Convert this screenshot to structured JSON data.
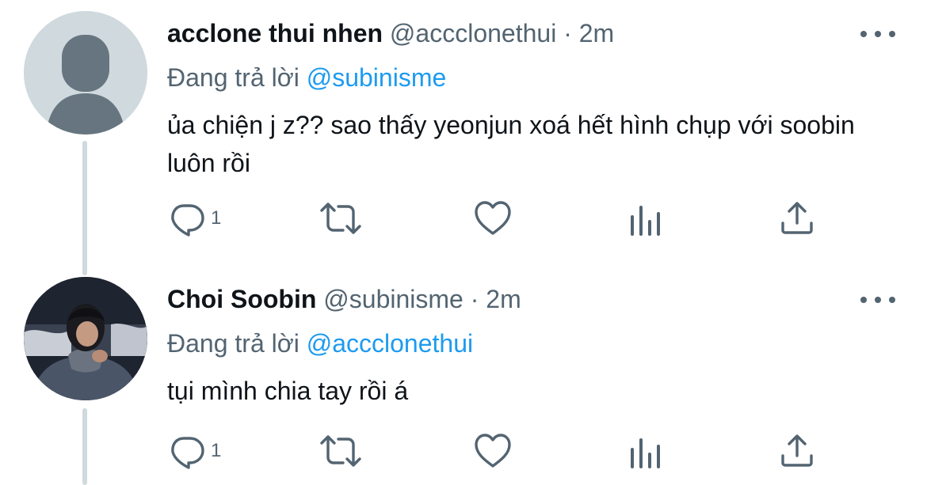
{
  "tweets": [
    {
      "author": {
        "name": "acclone thui nhen",
        "handle": "@accclonethui",
        "avatar_icon": "default-avatar-icon"
      },
      "separator": "·",
      "time": "2m",
      "replying_prefix": "Đang trả lời",
      "replying_to": "@subinisme",
      "text": "ủa chiện j z?? sao thấy yeonjun xoá hết hình chụp với soobin luôn rồi",
      "actions": {
        "reply_count": "1",
        "icons": [
          "reply-icon",
          "retweet-icon",
          "like-icon",
          "analytics-icon",
          "share-icon"
        ]
      }
    },
    {
      "author": {
        "name": "Choi Soobin",
        "handle": "@subinisme",
        "avatar_icon": "profile-photo"
      },
      "separator": "·",
      "time": "2m",
      "replying_prefix": "Đang trả lời",
      "replying_to": "@accclonethui",
      "text": "tụi mình chia tay rồi á",
      "actions": {
        "reply_count": "1",
        "icons": [
          "reply-icon",
          "retweet-icon",
          "like-icon",
          "analytics-icon",
          "share-icon"
        ]
      }
    }
  ],
  "colors": {
    "text": "#0f1419",
    "secondary": "#536471",
    "link": "#1d9bf0",
    "thread_line": "#cfd9de"
  }
}
